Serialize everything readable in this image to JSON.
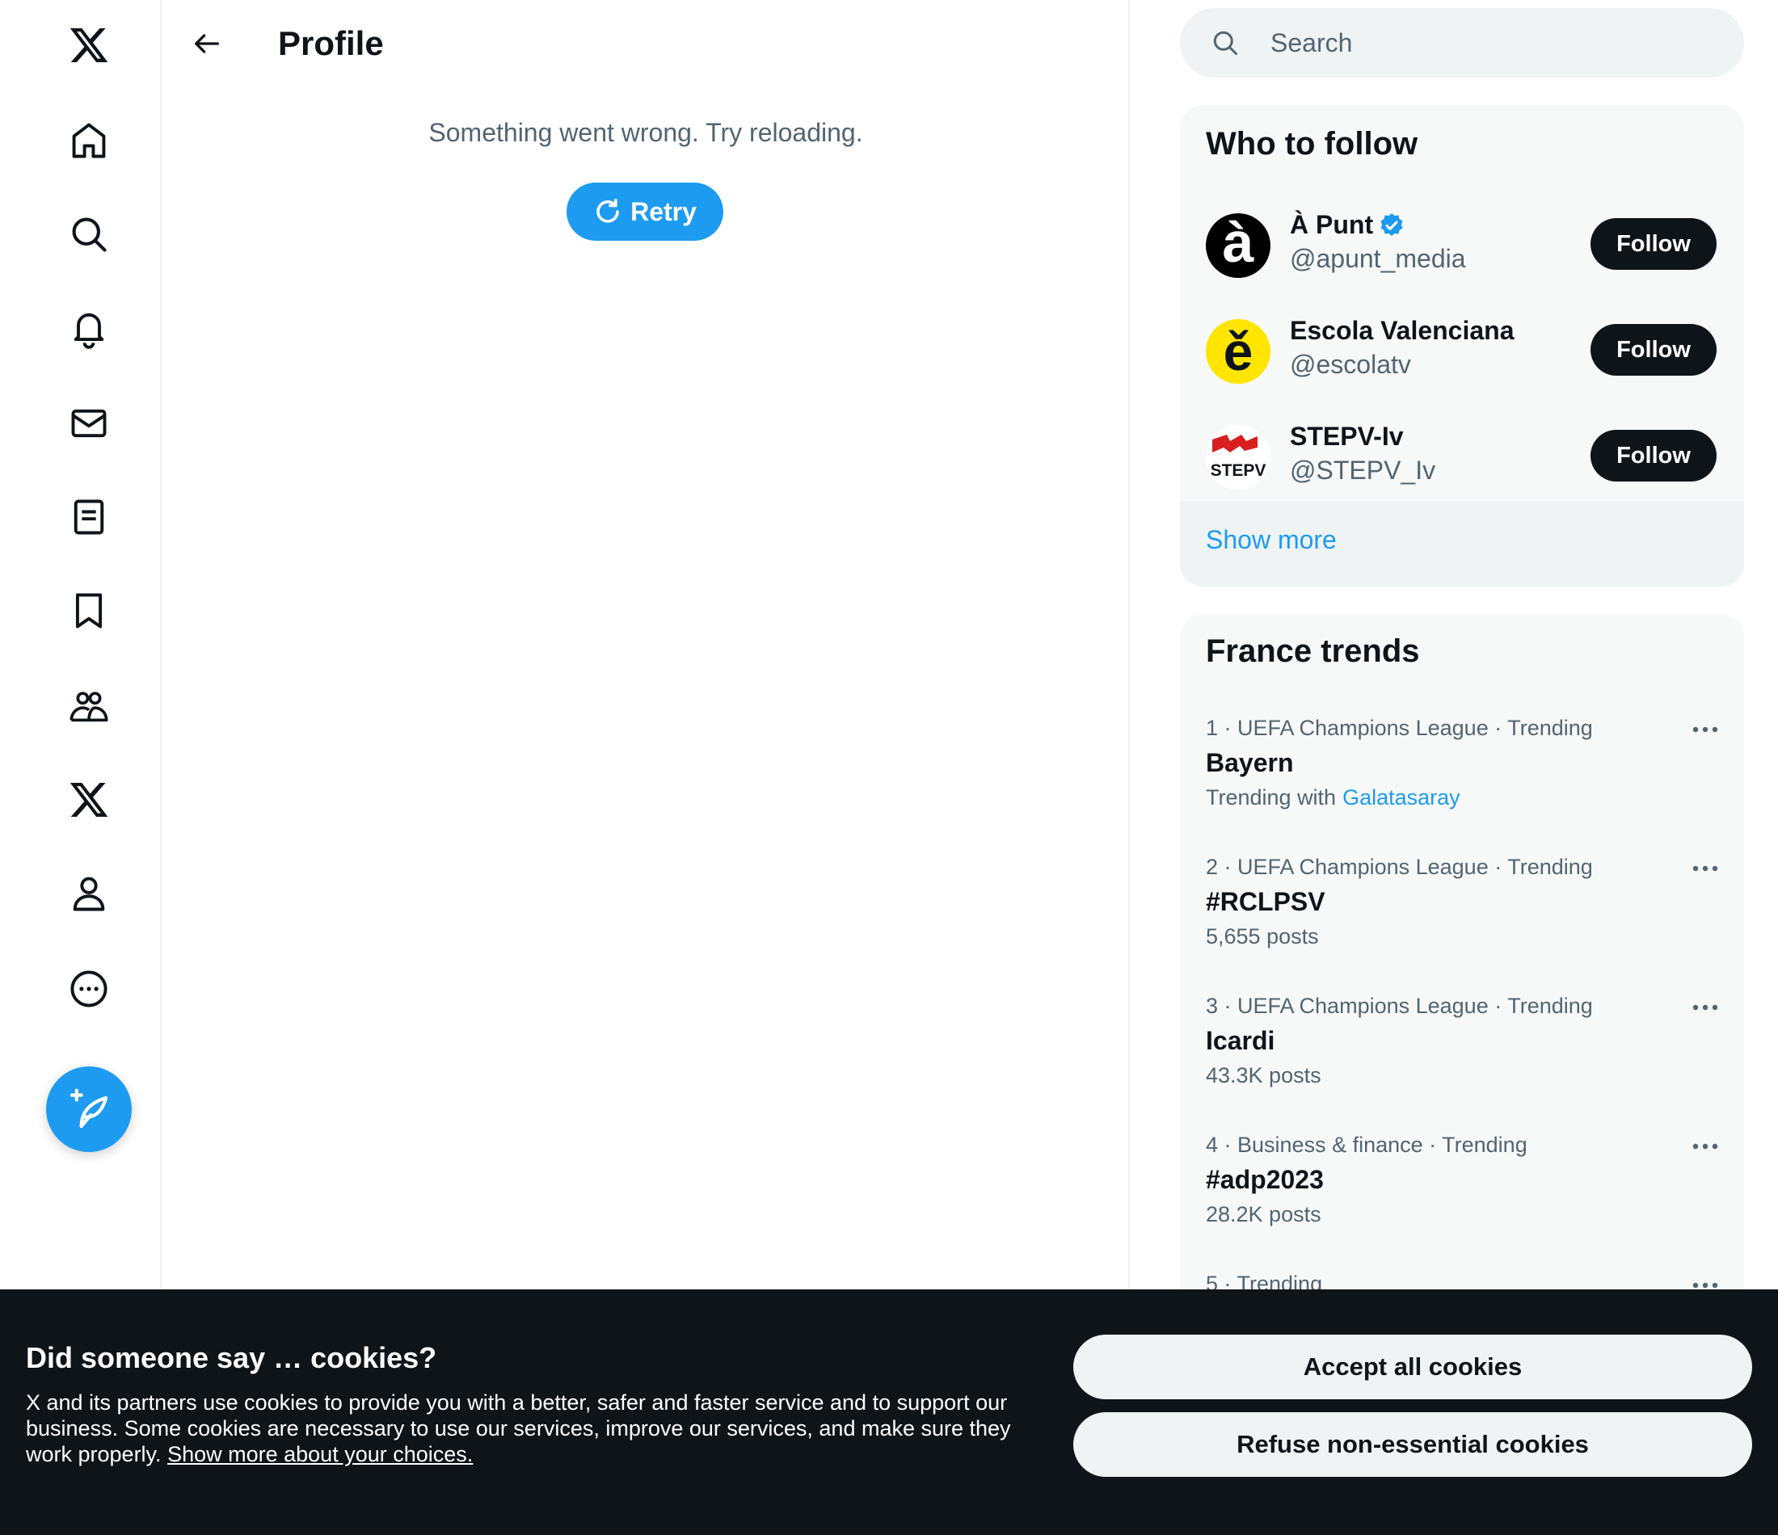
{
  "nav": {
    "items": [
      {
        "icon": "x-logo-icon"
      },
      {
        "icon": "home-icon"
      },
      {
        "icon": "search-icon"
      },
      {
        "icon": "bell-icon"
      },
      {
        "icon": "mail-icon"
      },
      {
        "icon": "lists-icon"
      },
      {
        "icon": "bookmark-icon"
      },
      {
        "icon": "communities-icon"
      },
      {
        "icon": "premium-x-icon"
      },
      {
        "icon": "profile-icon"
      },
      {
        "icon": "more-icon"
      }
    ],
    "compose_icon": "compose-feather-icon",
    "accent": "#1d9bf0"
  },
  "main": {
    "title": "Profile",
    "error_message": "Something went wrong. Try reloading.",
    "retry_label": "Retry"
  },
  "search": {
    "placeholder": "Search"
  },
  "who_to_follow": {
    "title": "Who to follow",
    "accounts": [
      {
        "name": "À Punt",
        "handle": "@apunt_media",
        "verified": true,
        "follow_label": "Follow",
        "avatar_letter": "à"
      },
      {
        "name": "Escola Valenciana",
        "handle": "@escolatv",
        "verified": false,
        "follow_label": "Follow",
        "avatar_letter": "ě"
      },
      {
        "name": "STEPV-Iv",
        "handle": "@STEPV_Iv",
        "verified": false,
        "follow_label": "Follow",
        "avatar_letter": "STEPV"
      }
    ],
    "show_more": "Show more"
  },
  "trends": {
    "title": "France trends",
    "items": [
      {
        "meta": "1 · UEFA Champions League · Trending",
        "name": "Bayern",
        "sub": "Trending with",
        "sub_link": "Galatasaray"
      },
      {
        "meta": "2 · UEFA Champions League · Trending",
        "name": "#RCLPSV",
        "sub": "5,655 posts"
      },
      {
        "meta": "3 · UEFA Champions League · Trending",
        "name": "Icardi",
        "sub": "43.3K posts"
      },
      {
        "meta": "4 · Business & finance · Trending",
        "name": "#adp2023",
        "sub": "28.2K posts"
      },
      {
        "meta": "5 · Trending"
      }
    ]
  },
  "cookie": {
    "title": "Did someone say … cookies?",
    "text": "X and its partners use cookies to provide you with a better, safer and faster service and to support our business. Some cookies are necessary to use our services, improve our services, and make sure they work properly.",
    "link": "Show more about your choices.",
    "accept_label": "Accept all cookies",
    "refuse_label": "Refuse non-essential cookies"
  }
}
